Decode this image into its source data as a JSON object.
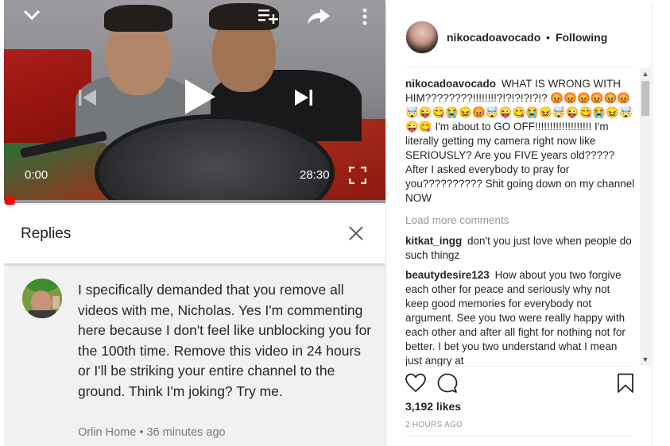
{
  "video": {
    "current_time": "0:00",
    "total_time": "28:30",
    "progress": 0
  },
  "replies": {
    "title": "Replies",
    "comment": {
      "text": "I specifically demanded that you remove all videos with me, Nicholas. Yes I'm commenting here because I don't feel like unblocking you for the 100th time. Remove this video in 24 hours or I'll be striking your entire channel to the ground. Think I'm joking? Try me.",
      "author": "Orlin Home",
      "separator": "•",
      "time": "36 minutes ago"
    }
  },
  "instagram": {
    "header": {
      "username": "nikocadoavocado",
      "separator": "•",
      "follow_status": "Following"
    },
    "caption": {
      "username": "nikocadoavocado",
      "text": "WHAT IS WRONG WITH HIM????????!!!!!!!!?!?!?!?!?!? 😡😡😡😡😡😡🤯😜😋😭😖😡🤯😜😋😭😖🤯😜😋😭😖🤯😜😋 I'm about to GO OFF!!!!!!!!!!!!!!!!!!! I'm literally getting my camera right now like SERIOUSLY? Are you FIVE years old????? After I asked everybody to pray for you?????????? Shit going down on my channel NOW"
    },
    "load_more": "Load more comments",
    "comments": [
      {
        "username": "kitkat_ingg",
        "text": "don't you just love when people do such thingz"
      },
      {
        "username": "beautydesire123",
        "text": "How about you two forgive each other for peace and seriously why not keep good memories for everybody not argument. See you two were really happy with each other and after all fight for nothing not for better. I bet you two understand what I mean just angry at"
      }
    ],
    "likes": "3,192 likes",
    "posted": "2 HOURS AGO"
  },
  "icons": {
    "collapse": "chevron-down-icon",
    "add_to_queue": "playlist-add-icon",
    "share": "share-icon",
    "more": "more-vert-icon",
    "previous": "skip-previous-icon",
    "play": "play-icon",
    "next": "skip-next-icon",
    "fullscreen": "fullscreen-icon",
    "close": "close-icon",
    "like": "heart-icon",
    "comment": "comment-icon",
    "save": "bookmark-icon"
  },
  "colors": {
    "progress": "#ff0000",
    "ig_text": "#262626",
    "muted": "#999999"
  }
}
